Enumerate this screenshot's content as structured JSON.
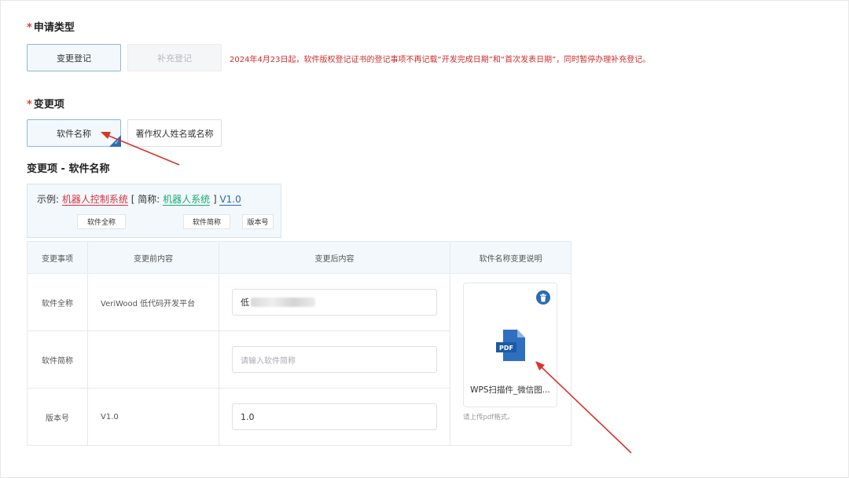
{
  "apply_type": {
    "label": "申请类型",
    "options": [
      {
        "label": "变更登记",
        "state": "selected"
      },
      {
        "label": "补充登记",
        "state": "disabled"
      }
    ],
    "notice": "2024年4月23日起，软件版权登记证书的登记事项不再记载“开发完成日期”和“首次发表日期”，同时暂停办理补充登记。"
  },
  "change_items": {
    "label": "变更项",
    "options": [
      {
        "label": "软件名称",
        "state": "selected"
      },
      {
        "label": "著作权人姓名或名称",
        "state": "normal"
      }
    ]
  },
  "section": {
    "title": "变更项 - 软件名称"
  },
  "example": {
    "prefix": "示例:",
    "full_name": "机器人控制系统",
    "short_prefix": "[ 简称:",
    "short_name": "机器人系统",
    "short_suffix": "]",
    "version": "V1.0",
    "tags": [
      "软件全称",
      "软件简称",
      "版本号"
    ]
  },
  "table": {
    "headers": [
      "变更事项",
      "变更前内容",
      "变更后内容",
      "软件名称变更说明"
    ],
    "rows": [
      {
        "item": "软件全称",
        "before": "VeriWood 低代码开发平台",
        "after_value": "低",
        "after_placeholder": ""
      },
      {
        "item": "软件简称",
        "before": "",
        "after_value": "",
        "after_placeholder": "请输入软件简称"
      },
      {
        "item": "版本号",
        "before": "V1.0",
        "after_value": "1.0",
        "after_placeholder": ""
      }
    ]
  },
  "upload": {
    "file_name": "WPS扫描件_微信图...",
    "file_icon": "pdf-file-icon",
    "file_badge": "PDF",
    "delete_icon": "trash-icon",
    "hint": "请上传pdf格式。"
  },
  "colors": {
    "accent": "#2b6bb3",
    "required": "#e03c3c",
    "notice": "#d12c2c",
    "annotation_arrow": "#d9342b"
  }
}
